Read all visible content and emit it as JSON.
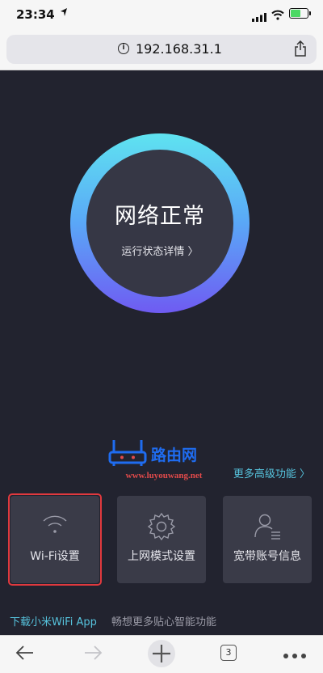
{
  "status_bar": {
    "time": "23:34",
    "location_arrow": "location-arrow-icon"
  },
  "browser": {
    "url": "192.168.31.1",
    "tab_count": "3"
  },
  "main": {
    "status_title": "网络正常",
    "status_link": "运行状态详情 〉",
    "watermark": {
      "brand": "路由网",
      "url": "www.luyouwang.net"
    },
    "more_link": "更多高级功能 〉",
    "tiles": [
      {
        "label": "Wi-Fi设置",
        "icon": "wifi-icon"
      },
      {
        "label": "上网模式设置",
        "icon": "gear-icon"
      },
      {
        "label": "宽带账号信息",
        "icon": "user-card-icon"
      }
    ],
    "download_link": "下载小米WiFi App",
    "download_text": "畅想更多贴心智能功能"
  },
  "colors": {
    "accent": "#56c3dd",
    "background": "#22232f",
    "tile": "#3a3b48",
    "highlight": "#e0393e"
  }
}
